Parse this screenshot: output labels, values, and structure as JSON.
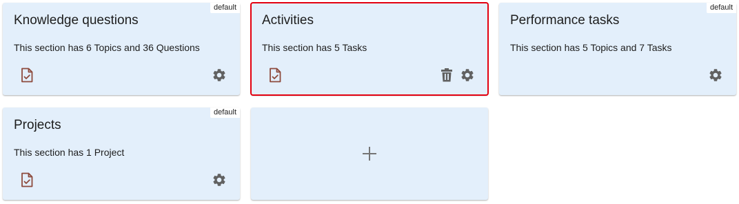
{
  "cards": [
    {
      "title": "Knowledge questions",
      "description": "This section has 6 Topics and 36 Questions",
      "badge": "default",
      "icons": [
        "doc-check-icon",
        "gear-icon"
      ]
    },
    {
      "title": "Activities",
      "description": "This section has 5 Tasks",
      "selected": true,
      "icons": [
        "doc-check-icon",
        "trash-icon",
        "gear-icon"
      ]
    },
    {
      "title": "Performance tasks",
      "description": "This section has 5 Topics and 7 Tasks",
      "badge": "default",
      "icons": [
        "gear-icon"
      ]
    },
    {
      "title": "Projects",
      "description": "This section has 1 Project",
      "badge": "default",
      "icons": [
        "doc-check-icon",
        "gear-icon"
      ]
    }
  ],
  "add_card": {
    "icon": "plus-icon"
  },
  "colors": {
    "card_bg": "#e3effb",
    "selected_outline": "#e3000f",
    "doc_icon": "#8d4a3c",
    "gear_icon": "#616161",
    "plus_icon": "#757575"
  }
}
